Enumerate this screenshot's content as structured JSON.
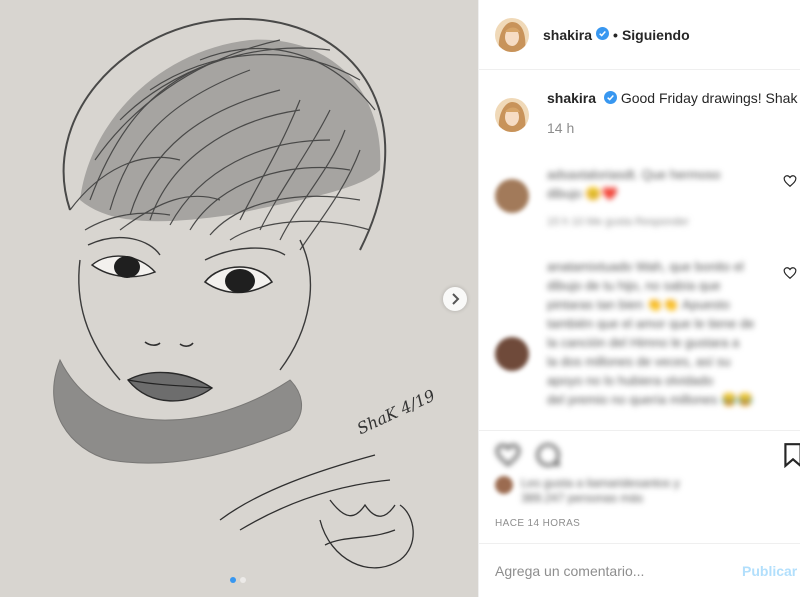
{
  "post": {
    "username": "shakira",
    "follow_status": "Siguiendo",
    "separator": "•",
    "caption_text": "Good Friday drawings! Shak",
    "caption_time": "14 h",
    "timestamp_upper": "HACE 14 HORAS",
    "artwork_signature": "ShaK 4/19"
  },
  "comments": [
    {
      "lines": [
        "adsaxtaloriasdt. Que hermoso",
        "dibujo 😊❤️"
      ],
      "meta": "15 h    10 Me gusta    Responder"
    },
    {
      "lines": [
        "anatamixtuado Wah, que bonito el",
        "dibujo de tu hijo, no sabía que",
        "pintaras tan bien 👏👏 Apuesto",
        "también que el amor que le tiene de",
        "la canción del Himno le gustara a",
        "la dos millones de veces, así su",
        "apoyo no lo hubiera olvidado",
        "del premio no quería millones 😂😂",
        "😂"
      ],
      "meta": ""
    }
  ],
  "likes_text": [
    "Les gusta a liamaridesantos y",
    "389.247 personas más"
  ],
  "add_comment": {
    "placeholder": "Agrega un comentario...",
    "publish_label": "Publicar"
  },
  "carousel": {
    "active_index": 0,
    "count": 2
  },
  "colors": {
    "verified": "#3897f0",
    "publish_disabled": "#b2dffc",
    "muted": "#8e8e8e"
  }
}
